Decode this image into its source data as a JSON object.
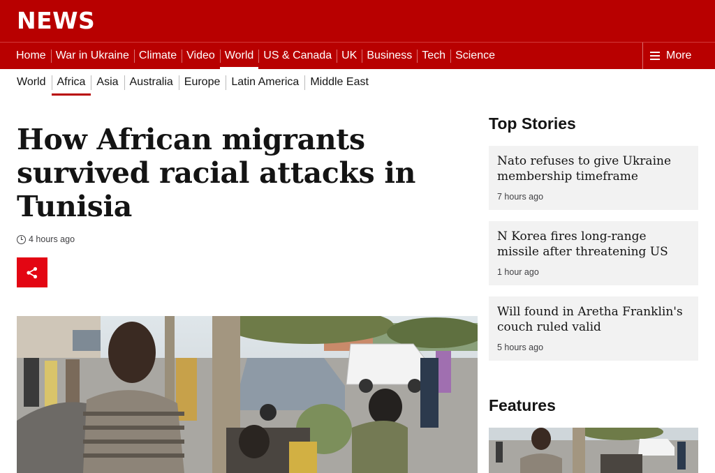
{
  "site": {
    "logo": "NEWS",
    "brand_color": "#b80000"
  },
  "primary_nav": {
    "items": [
      {
        "label": "Home"
      },
      {
        "label": "War in Ukraine"
      },
      {
        "label": "Climate"
      },
      {
        "label": "Video"
      },
      {
        "label": "World",
        "active": true
      },
      {
        "label": "US & Canada"
      },
      {
        "label": "UK"
      },
      {
        "label": "Business"
      },
      {
        "label": "Tech"
      },
      {
        "label": "Science"
      }
    ],
    "more_label": "More"
  },
  "sub_nav": {
    "items": [
      {
        "label": "World"
      },
      {
        "label": "Africa",
        "active": true
      },
      {
        "label": "Asia"
      },
      {
        "label": "Australia"
      },
      {
        "label": "Europe"
      },
      {
        "label": "Latin America"
      },
      {
        "label": "Middle East"
      }
    ]
  },
  "article": {
    "headline": "How African migrants survived racial attacks in Tunisia",
    "timestamp": "4 hours ago",
    "share_icon": "share-icon",
    "share_color": "#e30613"
  },
  "top_stories": {
    "heading": "Top Stories",
    "items": [
      {
        "title": "Nato refuses to give Ukraine membership timeframe",
        "age": "7 hours ago"
      },
      {
        "title": "N Korea fires long-range missile after threatening US",
        "age": "1 hour ago"
      },
      {
        "title": "Will found in Aretha Franklin's couch ruled valid",
        "age": "5 hours ago"
      }
    ]
  },
  "features": {
    "heading": "Features"
  }
}
